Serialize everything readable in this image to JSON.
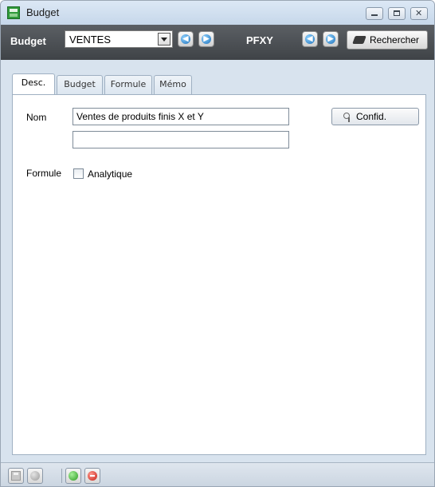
{
  "window": {
    "title": "Budget"
  },
  "toolbar": {
    "budget_label": "Budget",
    "budget_value": "VENTES",
    "code_label": "PFXY",
    "search_label": "Rechercher"
  },
  "tabs": [
    {
      "label": "Desc.",
      "active": true
    },
    {
      "label": "Budget",
      "active": false
    },
    {
      "label": "Formule",
      "active": false
    },
    {
      "label": "Mémo",
      "active": false
    }
  ],
  "form": {
    "nom_label": "Nom",
    "nom_value": "Ventes de produits finis X et Y",
    "nom_second_value": "",
    "confid_label": "Confid.",
    "formule_label": "Formule",
    "analytique_label": "Analytique",
    "analytique_checked": false
  },
  "icons": {
    "app": "budget-app-icon",
    "prev": "navigate-previous-icon",
    "next": "navigate-next-icon",
    "search": "search-icon",
    "confid": "key-icon",
    "save": "save-disk-icon",
    "cancel": "cancel-icon",
    "validate": "validate-icon",
    "delete": "delete-icon"
  }
}
